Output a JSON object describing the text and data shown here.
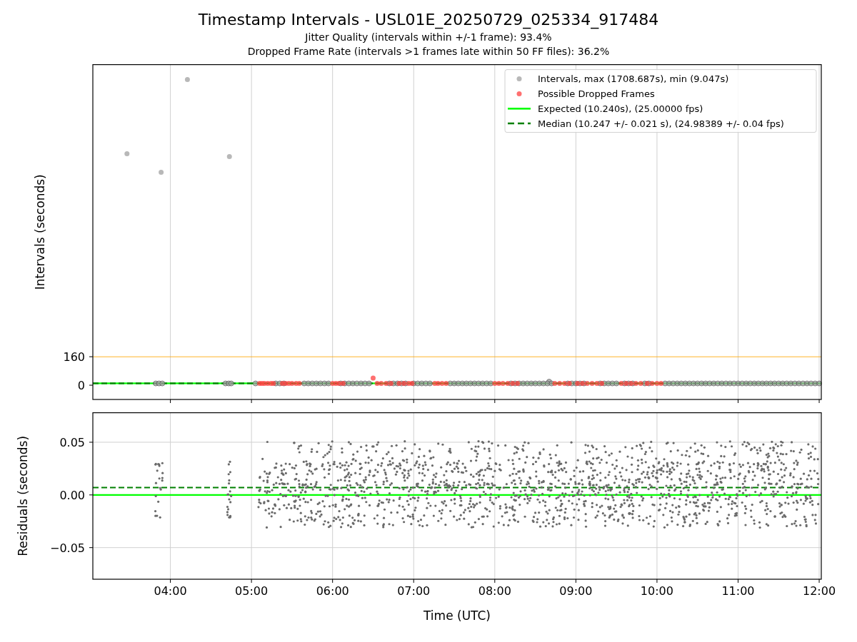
{
  "figure": {
    "title": "Timestamp Intervals - USL01E_20250729_025334_917484",
    "subtitles": [
      "Jitter Quality (intervals within +/-1 frame): 93.4%",
      "Dropped Frame Rate (intervals >1 frames late within 50 FF files): 36.2%"
    ]
  },
  "charts": [
    {
      "chart_data": {
        "type": "scatter",
        "ylabel": "Intervals (seconds)",
        "xlim": [
          3.044,
          12.026
        ],
        "ylim": [
          -80,
          1800
        ],
        "yticks": [
          {
            "value": 0,
            "label": "0"
          },
          {
            "value": 160,
            "label": "160"
          }
        ],
        "series": [
          {
            "name": "Intervals, max (1708.687s), min (9.047s)",
            "color": "#a0a0a0",
            "type": "scatter",
            "x": [
              3.465,
              3.886,
              4.21,
              4.728,
              3.82,
              3.86,
              3.9,
              4.68,
              4.72,
              4.75,
              8.67,
              5.05,
              5.3,
              5.35,
              5.4,
              5.65,
              5.7,
              5.75,
              5.8,
              5.85,
              5.9,
              5.95,
              6.1,
              6.15,
              6.2,
              6.25,
              6.3,
              6.35,
              6.4,
              6.45,
              6.7,
              6.75,
              6.8,
              6.85,
              6.9,
              7.0,
              7.05,
              7.1,
              7.15,
              7.2,
              7.45,
              7.5,
              7.55,
              7.6,
              7.65,
              7.7,
              7.75,
              7.8,
              7.85,
              7.9,
              7.95,
              8.2,
              8.25,
              8.3,
              8.35,
              8.4,
              8.45,
              8.5,
              8.55,
              8.6,
              8.65,
              8.7,
              8.9,
              8.95,
              9.0,
              9.05,
              9.1,
              9.3,
              9.35,
              9.4,
              9.45,
              9.5,
              9.6,
              9.65,
              9.7,
              9.85,
              9.9,
              10.1,
              10.15,
              10.2,
              10.25,
              10.3,
              10.35,
              10.4,
              10.45,
              10.5,
              10.55,
              10.6,
              10.65,
              10.7,
              10.75,
              10.8,
              10.85,
              10.9,
              10.95,
              11.0,
              11.05,
              11.1,
              11.15,
              11.2,
              11.25,
              11.3,
              11.35,
              11.4,
              11.45,
              11.5,
              11.55,
              11.6,
              11.65,
              11.7,
              11.75,
              11.8,
              11.85,
              11.9,
              11.95,
              12.0
            ],
            "values": [
              1300,
              1196,
              1716,
              1284,
              10,
              10,
              10,
              10,
              10,
              10,
              20,
              10,
              10,
              10,
              10,
              10,
              10,
              10,
              10,
              10,
              10,
              10,
              10,
              10,
              10,
              10,
              10,
              10,
              10,
              10,
              10,
              10,
              10,
              10,
              10,
              10,
              10,
              10,
              10,
              10,
              10,
              10,
              10,
              10,
              10,
              10,
              10,
              10,
              10,
              10,
              10,
              10,
              10,
              10,
              10,
              10,
              10,
              10,
              10,
              10,
              10,
              10,
              10,
              10,
              10,
              10,
              10,
              10,
              10,
              10,
              10,
              10,
              10,
              10,
              10,
              10,
              10,
              10,
              10,
              10,
              10,
              10,
              10,
              10,
              10,
              10,
              10,
              10,
              10,
              10,
              10,
              10,
              10,
              10,
              10,
              10,
              10,
              10,
              10,
              10,
              10,
              10,
              10,
              10,
              10,
              10,
              10,
              10,
              10,
              10,
              10,
              10,
              10,
              10,
              10,
              10
            ]
          },
          {
            "name": "Possible Dropped Frames",
            "color": "#ff4040",
            "type": "scatter",
            "x": [
              5.1,
              5.13,
              5.16,
              5.2,
              5.24,
              5.27,
              5.38,
              5.42,
              5.46,
              5.5,
              5.55,
              5.59,
              6.0,
              6.04,
              6.08,
              6.13,
              6.5,
              6.55,
              6.6,
              6.66,
              6.72,
              6.82,
              6.88,
              6.94,
              6.98,
              7.26,
              7.3,
              7.35,
              7.4,
              8.0,
              8.05,
              8.1,
              8.16,
              8.22,
              8.28,
              8.74,
              8.8,
              8.86,
              8.92,
              9.02,
              9.08,
              9.14,
              9.2,
              9.26,
              9.32,
              9.56,
              9.62,
              9.68,
              9.74,
              9.8,
              9.88,
              9.94,
              10.0,
              10.05
            ],
            "values": [
              10,
              10,
              10,
              10,
              10,
              10,
              10,
              10,
              10,
              10,
              10,
              10,
              10,
              10,
              10,
              10,
              40,
              10,
              10,
              10,
              10,
              10,
              10,
              10,
              10,
              10,
              10,
              10,
              10,
              10,
              10,
              10,
              10,
              10,
              10,
              10,
              10,
              10,
              10,
              10,
              10,
              10,
              10,
              10,
              10,
              10,
              10,
              10,
              10,
              10,
              10,
              10,
              10,
              10
            ]
          },
          {
            "name": "Expected (10.240s), (25.00000 fps)",
            "color": "#00ff00",
            "type": "line",
            "x": [
              3.044,
              12.026
            ],
            "values": [
              10.24,
              10.24
            ]
          },
          {
            "name": "Median (10.247 +/- 0.021 s), (24.98389 +/- 0.04 fps)",
            "color": "#008000",
            "type": "line",
            "line_style": "dashed",
            "x": [
              3.044,
              12.026
            ],
            "values": [
              10.247,
              10.247
            ]
          }
        ],
        "ref_lines": [
          {
            "axis": "y",
            "value": 160,
            "color": "#ffa500"
          }
        ],
        "grid": "x",
        "legend": true
      }
    },
    {
      "chart_data": {
        "type": "scatter",
        "xlabel": "Time (UTC)",
        "ylabel": "Residuals (seconds)",
        "xlim": [
          3.044,
          12.026
        ],
        "ylim": [
          -0.08,
          0.078
        ],
        "xticks": [
          {
            "value": 4,
            "label": "04:00"
          },
          {
            "value": 5,
            "label": "05:00"
          },
          {
            "value": 6,
            "label": "06:00"
          },
          {
            "value": 7,
            "label": "07:00"
          },
          {
            "value": 8,
            "label": "08:00"
          },
          {
            "value": 9,
            "label": "09:00"
          },
          {
            "value": 10,
            "label": "10:00"
          },
          {
            "value": 11,
            "label": "11:00"
          },
          {
            "value": 12,
            "label": "12:00"
          }
        ],
        "yticks": [
          {
            "value": 0.05,
            "label": "0.05"
          },
          {
            "value": 0,
            "label": "0.00"
          },
          {
            "value": -0.05,
            "label": "−0.05"
          }
        ],
        "ref_lines": [
          {
            "axis": "y",
            "value": 0,
            "color": "#00ff00"
          },
          {
            "axis": "y",
            "value": 0.007,
            "color": "#008000",
            "line_style": "dashed"
          }
        ],
        "grid": "both"
      }
    }
  ]
}
